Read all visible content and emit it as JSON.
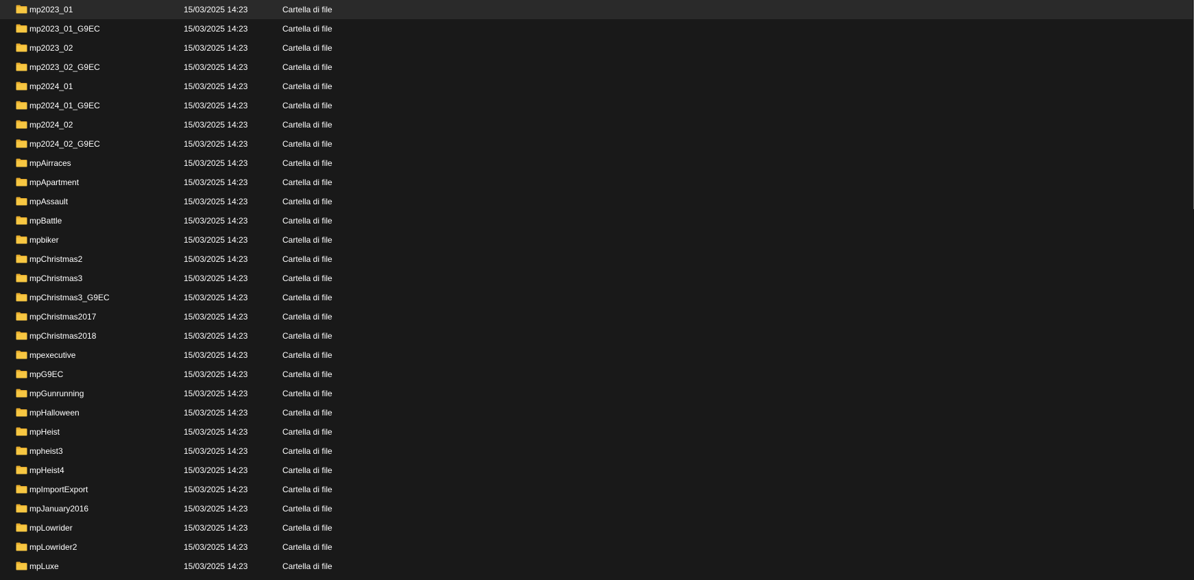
{
  "colors": {
    "background": "#191919",
    "text": "#ffffff",
    "folder_icon": "#f7c742"
  },
  "rows": [
    {
      "name": "mp2023_01",
      "date": "15/03/2025 14:23",
      "type": "Cartella di file",
      "icon": "folder-icon"
    },
    {
      "name": "mp2023_01_G9EC",
      "date": "15/03/2025 14:23",
      "type": "Cartella di file",
      "icon": "folder-icon"
    },
    {
      "name": "mp2023_02",
      "date": "15/03/2025 14:23",
      "type": "Cartella di file",
      "icon": "folder-icon"
    },
    {
      "name": "mp2023_02_G9EC",
      "date": "15/03/2025 14:23",
      "type": "Cartella di file",
      "icon": "folder-icon"
    },
    {
      "name": "mp2024_01",
      "date": "15/03/2025 14:23",
      "type": "Cartella di file",
      "icon": "folder-icon"
    },
    {
      "name": "mp2024_01_G9EC",
      "date": "15/03/2025 14:23",
      "type": "Cartella di file",
      "icon": "folder-icon"
    },
    {
      "name": "mp2024_02",
      "date": "15/03/2025 14:23",
      "type": "Cartella di file",
      "icon": "folder-icon"
    },
    {
      "name": "mp2024_02_G9EC",
      "date": "15/03/2025 14:23",
      "type": "Cartella di file",
      "icon": "folder-icon"
    },
    {
      "name": "mpAirraces",
      "date": "15/03/2025 14:23",
      "type": "Cartella di file",
      "icon": "folder-icon"
    },
    {
      "name": "mpApartment",
      "date": "15/03/2025 14:23",
      "type": "Cartella di file",
      "icon": "folder-icon"
    },
    {
      "name": "mpAssault",
      "date": "15/03/2025 14:23",
      "type": "Cartella di file",
      "icon": "folder-icon"
    },
    {
      "name": "mpBattle",
      "date": "15/03/2025 14:23",
      "type": "Cartella di file",
      "icon": "folder-icon"
    },
    {
      "name": "mpbiker",
      "date": "15/03/2025 14:23",
      "type": "Cartella di file",
      "icon": "folder-icon"
    },
    {
      "name": "mpChristmas2",
      "date": "15/03/2025 14:23",
      "type": "Cartella di file",
      "icon": "folder-icon"
    },
    {
      "name": "mpChristmas3",
      "date": "15/03/2025 14:23",
      "type": "Cartella di file",
      "icon": "folder-icon"
    },
    {
      "name": "mpChristmas3_G9EC",
      "date": "15/03/2025 14:23",
      "type": "Cartella di file",
      "icon": "folder-icon"
    },
    {
      "name": "mpChristmas2017",
      "date": "15/03/2025 14:23",
      "type": "Cartella di file",
      "icon": "folder-icon"
    },
    {
      "name": "mpChristmas2018",
      "date": "15/03/2025 14:23",
      "type": "Cartella di file",
      "icon": "folder-icon"
    },
    {
      "name": "mpexecutive",
      "date": "15/03/2025 14:23",
      "type": "Cartella di file",
      "icon": "folder-icon"
    },
    {
      "name": "mpG9EC",
      "date": "15/03/2025 14:23",
      "type": "Cartella di file",
      "icon": "folder-icon"
    },
    {
      "name": "mpGunrunning",
      "date": "15/03/2025 14:23",
      "type": "Cartella di file",
      "icon": "folder-icon"
    },
    {
      "name": "mpHalloween",
      "date": "15/03/2025 14:23",
      "type": "Cartella di file",
      "icon": "folder-icon"
    },
    {
      "name": "mpHeist",
      "date": "15/03/2025 14:23",
      "type": "Cartella di file",
      "icon": "folder-icon"
    },
    {
      "name": "mpheist3",
      "date": "15/03/2025 14:23",
      "type": "Cartella di file",
      "icon": "folder-icon"
    },
    {
      "name": "mpHeist4",
      "date": "15/03/2025 14:23",
      "type": "Cartella di file",
      "icon": "folder-icon"
    },
    {
      "name": "mpImportExport",
      "date": "15/03/2025 14:23",
      "type": "Cartella di file",
      "icon": "folder-icon"
    },
    {
      "name": "mpJanuary2016",
      "date": "15/03/2025 14:23",
      "type": "Cartella di file",
      "icon": "folder-icon"
    },
    {
      "name": "mpLowrider",
      "date": "15/03/2025 14:23",
      "type": "Cartella di file",
      "icon": "folder-icon"
    },
    {
      "name": "mpLowrider2",
      "date": "15/03/2025 14:23",
      "type": "Cartella di file",
      "icon": "folder-icon"
    },
    {
      "name": "mpLuxe",
      "date": "15/03/2025 14:23",
      "type": "Cartella di file",
      "icon": "folder-icon"
    }
  ]
}
